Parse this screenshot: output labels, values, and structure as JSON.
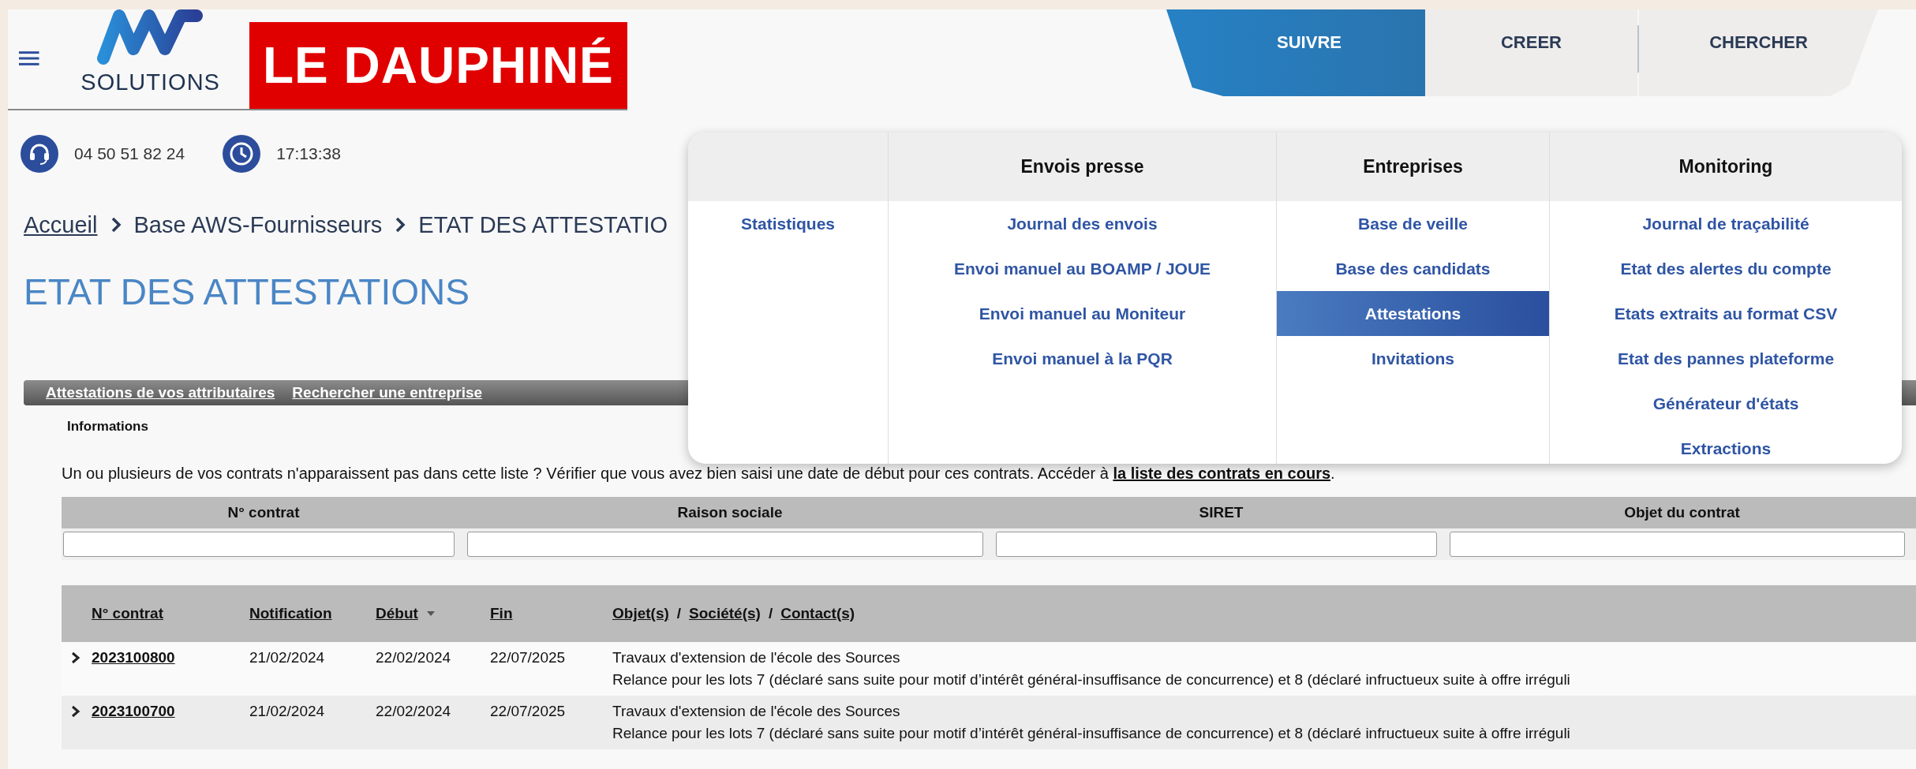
{
  "header": {
    "logo_text": "SOLUTIONS",
    "partner_logo": "LE DAUPHINÉ"
  },
  "nav_tabs": [
    {
      "label": "SUIVRE",
      "selected": true
    },
    {
      "label": "CREER",
      "selected": false
    },
    {
      "label": "CHERCHER",
      "selected": false
    }
  ],
  "contact": {
    "phone": "04 50 51 82 24",
    "time": "17:13:38"
  },
  "breadcrumb": [
    {
      "label": "Accueil",
      "kind": "link"
    },
    {
      "label": "Base AWS-Fournisseurs",
      "kind": "text"
    },
    {
      "label": "ETAT DES ATTESTATIO",
      "kind": "text"
    }
  ],
  "page_title": "ETAT DES ATTESTATIONS",
  "mega_menu": {
    "columns": [
      {
        "items": [
          {
            "label": "Statistiques",
            "selected": false
          }
        ]
      },
      {
        "heading": "Envois presse",
        "items": [
          {
            "label": "Journal des envois",
            "selected": false
          },
          {
            "label": "Envoi manuel au BOAMP / JOUE",
            "selected": false
          },
          {
            "label": "Envoi manuel au Moniteur",
            "selected": false
          },
          {
            "label": "Envoi manuel à la PQR",
            "selected": false
          }
        ]
      },
      {
        "heading": "Entreprises",
        "items": [
          {
            "label": "Base de veille",
            "selected": false
          },
          {
            "label": "Base des candidats",
            "selected": false
          },
          {
            "label": "Attestations",
            "selected": true
          },
          {
            "label": "Invitations",
            "selected": false
          }
        ]
      },
      {
        "heading": "Monitoring",
        "items": [
          {
            "label": "Journal de traçabilité",
            "selected": false
          },
          {
            "label": "Etat des alertes du compte",
            "selected": false
          },
          {
            "label": "Etats extraits au format CSV",
            "selected": false
          },
          {
            "label": "Etat des pannes plateforme",
            "selected": false
          },
          {
            "label": "Générateur d'états",
            "selected": false
          },
          {
            "label": "Extractions",
            "selected": false
          }
        ]
      }
    ]
  },
  "subnav": [
    {
      "label": "Attestations de vos attributaires"
    },
    {
      "label": "Rechercher une entreprise"
    }
  ],
  "section_label": "Informations",
  "notice": {
    "text": "Un ou plusieurs de vos contrats n'apparaissent pas dans cette liste ? Vérifier que vous avez bien saisi une date de début pour ces contrats. Accéder à ",
    "link": "la liste des contrats en cours",
    "end": "."
  },
  "filters": [
    {
      "label": "N° contrat"
    },
    {
      "label": "Raison sociale"
    },
    {
      "label": "SIRET"
    },
    {
      "label": "Objet du contrat"
    }
  ],
  "results": {
    "columns": [
      {
        "label": "N° contrat",
        "sorted": false
      },
      {
        "label": "Notification",
        "sorted": false
      },
      {
        "label": "Début",
        "sorted": true
      },
      {
        "label": "Fin",
        "sorted": false
      },
      {
        "parts": [
          "Objet(s)",
          "Société(s)",
          "Contact(s)"
        ],
        "separator": "/",
        "sorted": false
      }
    ],
    "rows": [
      {
        "expanded": false,
        "contract": "2023100800",
        "notification": "21/02/2024",
        "start": "22/02/2024",
        "end": "22/07/2025",
        "object_lines": [
          "Travaux d'extension de l'école des Sources",
          "Relance pour les lots 7 (déclaré sans suite pour motif d’intérêt général-insuffisance de concurrence) et 8 (déclaré infructueux suite à offre irréguli"
        ]
      },
      {
        "expanded": false,
        "contract": "2023100700",
        "notification": "21/02/2024",
        "start": "22/02/2024",
        "end": "22/07/2025",
        "object_lines": [
          "Travaux d'extension de l'école des Sources",
          "Relance pour les lots 7 (déclaré sans suite pour motif d’intérêt général-insuffisance de concurrence) et 8 (déclaré infructueux suite à offre irréguli"
        ]
      }
    ]
  }
}
